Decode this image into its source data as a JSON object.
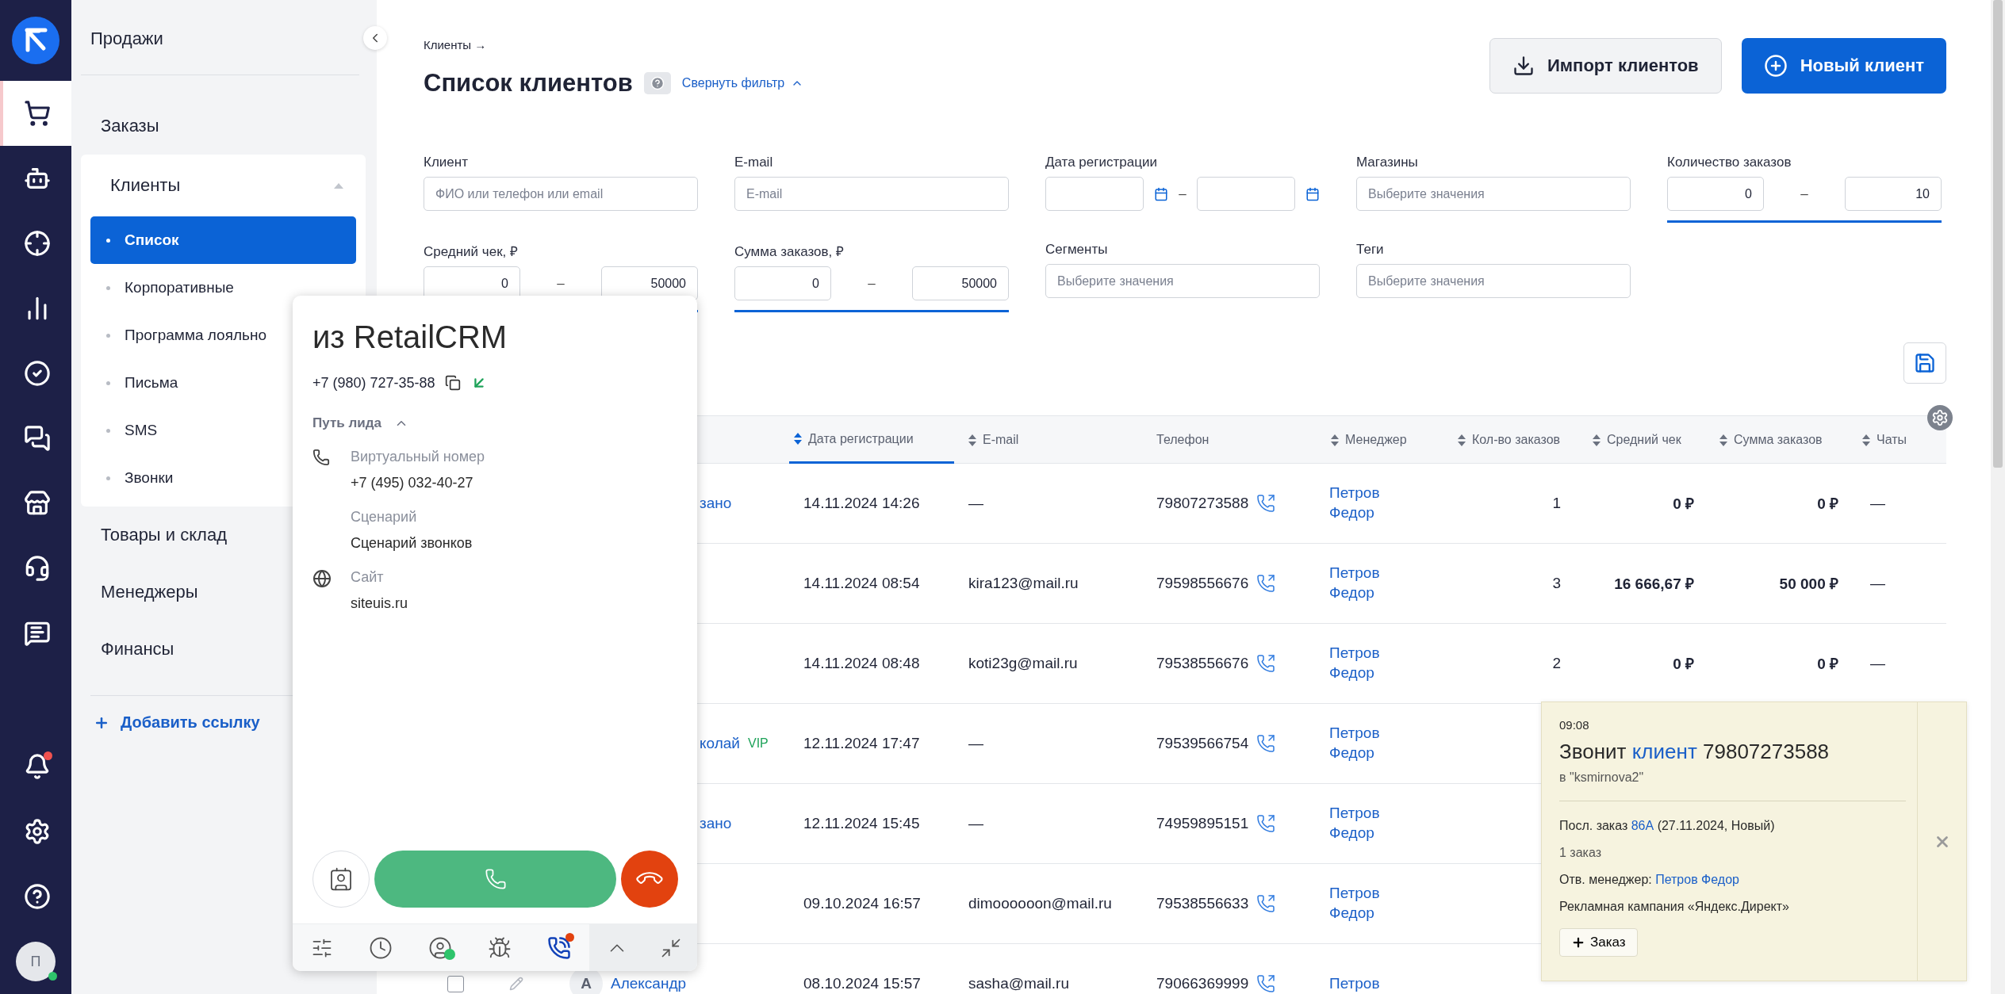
{
  "rail": {
    "items": [
      {
        "kind": "cart",
        "selected": true
      },
      {
        "kind": "bot",
        "selected": false
      },
      {
        "kind": "target",
        "selected": false
      },
      {
        "kind": "chart",
        "selected": false
      },
      {
        "kind": "check",
        "selected": false
      },
      {
        "kind": "chat",
        "selected": false
      },
      {
        "kind": "store",
        "selected": false
      },
      {
        "kind": "support",
        "selected": false
      },
      {
        "kind": "message",
        "selected": false
      }
    ],
    "bottom": [
      {
        "kind": "bell",
        "badge": true
      },
      {
        "kind": "settings"
      },
      {
        "kind": "help"
      }
    ],
    "user": {
      "initial": "П",
      "online": true
    }
  },
  "menu": {
    "title": "Продажи",
    "items": [
      {
        "label": "Заказы",
        "expanded": false
      },
      {
        "label": "Клиенты",
        "expanded": true,
        "children": [
          {
            "label": "Список",
            "selected": true
          },
          {
            "label": "Корпоративные",
            "selected": false
          },
          {
            "label": "Программа лояльно",
            "selected": false
          },
          {
            "label": "Письма",
            "selected": false
          },
          {
            "label": "SMS",
            "selected": false
          },
          {
            "label": "Звонки",
            "selected": false
          }
        ]
      },
      {
        "label": "Товары и склад",
        "expanded": false
      },
      {
        "label": "Менеджеры",
        "expanded": false
      },
      {
        "label": "Финансы",
        "expanded": false
      }
    ],
    "add_link": "Добавить ссылку"
  },
  "header": {
    "breadcrumb": "Клиенты →",
    "title": "Список клиентов",
    "collapse": "Свернуть фильтр",
    "buttons": [
      {
        "kind": "import",
        "label": "Импорт клиентов"
      },
      {
        "kind": "create",
        "label": "Новый клиент"
      }
    ]
  },
  "filters": [
    {
      "kind": "text",
      "label": "Клиент",
      "placeholder": "ФИО или телефон или email"
    },
    {
      "kind": "text",
      "label": "E-mail",
      "placeholder": "E-mail"
    },
    {
      "kind": "date",
      "label": "Дата регистрации",
      "separator": "–"
    },
    {
      "kind": "select",
      "label": "Магазины",
      "placeholder": "Выберите значения"
    },
    {
      "kind": "range",
      "label": "Количество заказов",
      "from": "0",
      "to": "10",
      "separator": "–",
      "active": true
    },
    {
      "kind": "range",
      "label": "Средний чек, ₽",
      "from": "0",
      "to": "50000",
      "separator": "–",
      "active": true
    },
    {
      "kind": "range",
      "label": "Сумма заказов, ₽",
      "from": "0",
      "to": "50000",
      "separator": "–",
      "active": true
    },
    {
      "kind": "select",
      "label": "Сегменты",
      "placeholder": "Выберите значения"
    },
    {
      "kind": "select",
      "label": "Теги",
      "placeholder": "Выберите значения"
    }
  ],
  "table": {
    "columns": [
      {
        "label": "Дата регистрации",
        "sortable": true,
        "sorted": true
      },
      {
        "label": "E-mail",
        "sortable": true,
        "sorted": false
      },
      {
        "label": "Телефон",
        "sortable": false,
        "sorted": false
      },
      {
        "label": "Менеджер",
        "sortable": true,
        "sorted": false
      },
      {
        "label": "Кол-во заказов",
        "sortable": true,
        "sorted": false
      },
      {
        "label": "Средний чек",
        "sortable": true,
        "sorted": false
      },
      {
        "label": "Сумма заказов",
        "sortable": true,
        "sorted": false
      },
      {
        "label": "Чаты",
        "sortable": true,
        "sorted": false
      }
    ],
    "rows": [
      {
        "name": "зано",
        "date": "14.11.2024 14:26",
        "email": "—",
        "phone": "79807273588",
        "manager": "Петров Федор",
        "orders": "1",
        "avg": "0 ₽",
        "sum": "0 ₽",
        "chats": "—"
      },
      {
        "date": "14.11.2024 08:54",
        "email": "kira123@mail.ru",
        "phone": "79598556676",
        "manager": "Петров Федор",
        "orders": "3",
        "avg": "16 666,67 ₽",
        "sum": "50 000 ₽",
        "chats": "—"
      },
      {
        "date": "14.11.2024 08:48",
        "email": "koti23g@mail.ru",
        "phone": "79538556676",
        "manager": "Петров Федор",
        "orders": "2",
        "avg": "0 ₽",
        "sum": "0 ₽",
        "chats": "—"
      },
      {
        "name": "колай",
        "tag": "VIP",
        "date": "12.11.2024 17:47",
        "email": "—",
        "phone": "79539566754",
        "manager": "Петров Федор"
      },
      {
        "name": "зано",
        "date": "12.11.2024 15:45",
        "email": "—",
        "phone": "74959895151",
        "manager": "Петров Федор"
      },
      {
        "date": "09.10.2024 16:57",
        "email": "dimoooooon@mail.ru",
        "phone": "79538556633",
        "manager": "Петров Федор"
      },
      {
        "checked": false,
        "avatar": "A",
        "name": "Александр",
        "date": "08.10.2024 15:57",
        "email": "sasha@mail.ru",
        "phone": "79066369999",
        "manager": "Петров"
      }
    ]
  },
  "call_widget": {
    "title": "из RetailCRM",
    "phone": "+7 (980) 727-35-88",
    "section": "Путь лида",
    "expanded": true,
    "details": [
      {
        "label": "Виртуальный номер",
        "value": "+7 (495) 032-40-27"
      },
      {
        "label": "Сценарий",
        "value": "Сценарий звонков"
      },
      {
        "label": "Сайт",
        "value": "siteuis.ru"
      }
    ]
  },
  "notification": {
    "time": "09:08",
    "title": {
      "before": "Звонит ",
      "link": "клиент",
      "after": " 79807273588"
    },
    "account": "в \"ksmirnova2\"",
    "last_order": {
      "before": "Посл. заказ ",
      "link": "86А",
      "after": " (27.11.2024, Новый)"
    },
    "orders_count": "1 заказ",
    "manager": {
      "before": "Отв. менеджер: ",
      "link": "Петров Федор"
    },
    "campaign": "Рекламная кампания «Яндекс.Директ»",
    "button": "Заказ"
  }
}
